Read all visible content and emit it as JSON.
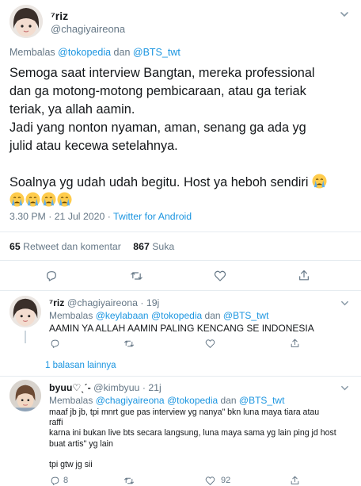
{
  "main_tweet": {
    "name": "⁷riz",
    "handle": "@chagiyaireona",
    "reply_prefix": "Membalas",
    "reply_to_1": "@tokopedia",
    "reply_and": "dan",
    "reply_to_2": "@BTS_twt",
    "text_lines": [
      "Semoga saat interview Bangtan, mereka professional",
      "dan ga motong-motong pembicaraan, atau ga teriak",
      "teriak, ya allah aamin.",
      "Jadi yang nonton nyaman, aman, senang ga ada yg",
      "julid atau kecewa setelahnya.",
      "Soalnya yg udah udah begitu. Host ya heboh sendiri"
    ],
    "timestamp": "3.30 PM · 21 Jul 2020 ·",
    "source": "Twitter for Android",
    "retweets_count": "65",
    "retweets_label": "Retweet dan komentar",
    "likes_count": "867",
    "likes_label": "Suka",
    "emoji": "crying-face-emoji"
  },
  "reply_1": {
    "name": "⁷riz",
    "handle": "@chagiyaireona",
    "time": "19j",
    "reply_prefix": "Membalas",
    "reply_to_1": "@keylabaan",
    "reply_to_2": "@tokopedia",
    "reply_and": "dan",
    "reply_to_3": "@BTS_twt",
    "text": "AAMIN YA ALLAH AAMIN PALING KENCANG SE INDONESIA",
    "more_replies": "1 balasan lainnya"
  },
  "reply_2": {
    "name": "byuu♡ˎˊ-",
    "handle": "@kimbyuu",
    "time": "21j",
    "reply_prefix": "Membalas",
    "reply_to_1": "@chagiyaireona",
    "reply_to_2": "@tokopedia",
    "reply_and": "dan",
    "reply_to_3": "@BTS_twt",
    "text_lines": [
      "maaf jb jb, tpi mnrt gue pas interview yg nanya\" bkn luna maya tiara atau",
      "raffi",
      "karna ini bukan live bts secara langsung, luna maya sama yg lain ping jd host",
      "buat artis\" yg lain",
      "tpi gtw jg sii"
    ],
    "reply_count": "8",
    "like_count": "92"
  },
  "colors": {
    "link": "#1b95e0",
    "secondary": "#657786",
    "icon": "#657786",
    "border": "#e6ecf0"
  }
}
